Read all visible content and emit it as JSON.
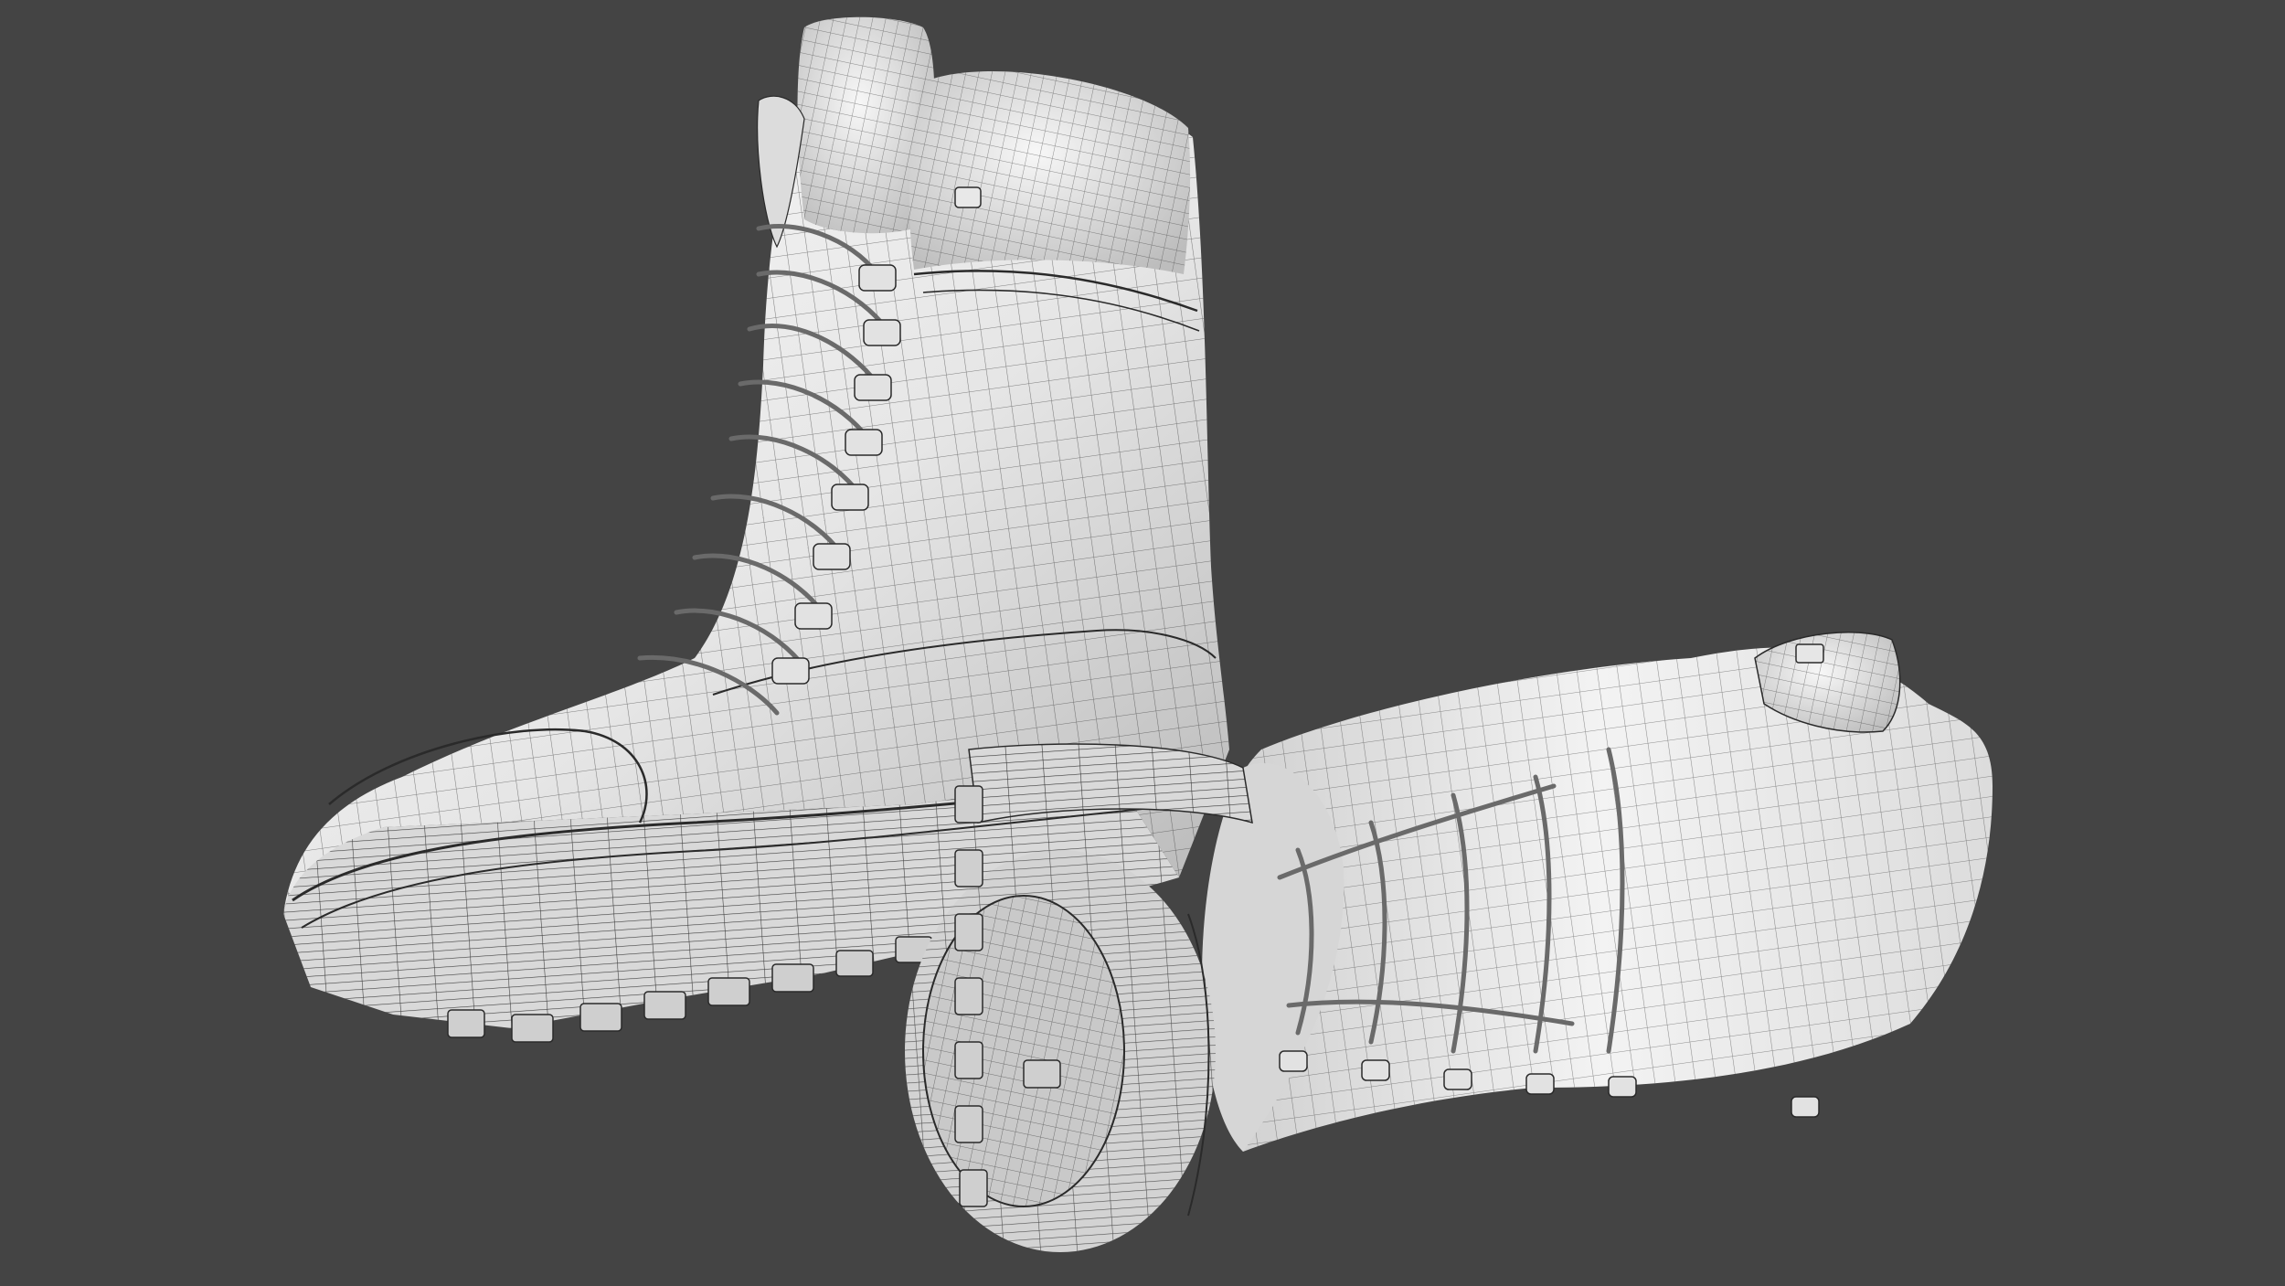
{
  "scene": {
    "background_color": "#444444",
    "mesh_color": "#f2f2f2",
    "wire_color": "#2a2a2a",
    "shadow_color": "#9a9a9a",
    "objects": [
      {
        "name": "standing-boot",
        "view": "side"
      },
      {
        "name": "lying-boot",
        "view": "sole-facing"
      }
    ],
    "shading_mode": "wireframe-on-shaded"
  }
}
